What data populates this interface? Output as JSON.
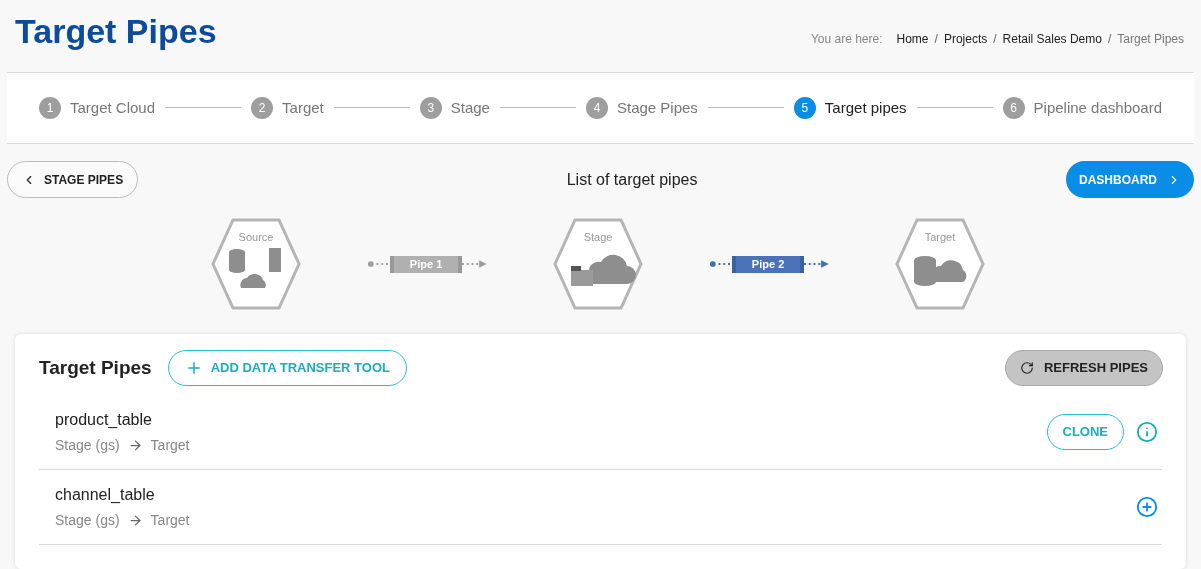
{
  "page_title": "Target Pipes",
  "breadcrumb": {
    "prefix": "You are here:",
    "items": [
      {
        "label": "Home",
        "current": false
      },
      {
        "label": "Projects",
        "current": false
      },
      {
        "label": "Retail Sales Demo",
        "current": false
      },
      {
        "label": "Target Pipes",
        "current": true
      }
    ],
    "separator": "/"
  },
  "steps": [
    {
      "number": "1",
      "label": "Target Cloud",
      "selected": false
    },
    {
      "number": "2",
      "label": "Target",
      "selected": false
    },
    {
      "number": "3",
      "label": "Stage",
      "selected": false
    },
    {
      "number": "4",
      "label": "Stage Pipes",
      "selected": false
    },
    {
      "number": "5",
      "label": "Target pipes",
      "selected": true
    },
    {
      "number": "6",
      "label": "Pipeline dashboard",
      "selected": false
    }
  ],
  "back_button": "STAGE PIPES",
  "heading": "List of target pipes",
  "next_button": "DASHBOARD",
  "diagram": [
    {
      "kind": "source",
      "label": "Source"
    },
    {
      "kind": "pipe",
      "label": "Pipe 1",
      "active": false
    },
    {
      "kind": "stage",
      "label": "Stage"
    },
    {
      "kind": "pipe",
      "label": "Pipe 2",
      "active": true
    },
    {
      "kind": "target",
      "label": "Target"
    }
  ],
  "card": {
    "title": "Target Pipes",
    "add_button": "ADD DATA TRANSFER TOOL",
    "refresh_button": "REFRESH PIPES",
    "rows": [
      {
        "name": "product_table",
        "from": "Stage (gs)",
        "to": "Target",
        "clone_button": "CLONE",
        "kind": "info"
      },
      {
        "name": "channel_table",
        "from": "Stage (gs)",
        "to": "Target",
        "kind": "add"
      }
    ]
  }
}
